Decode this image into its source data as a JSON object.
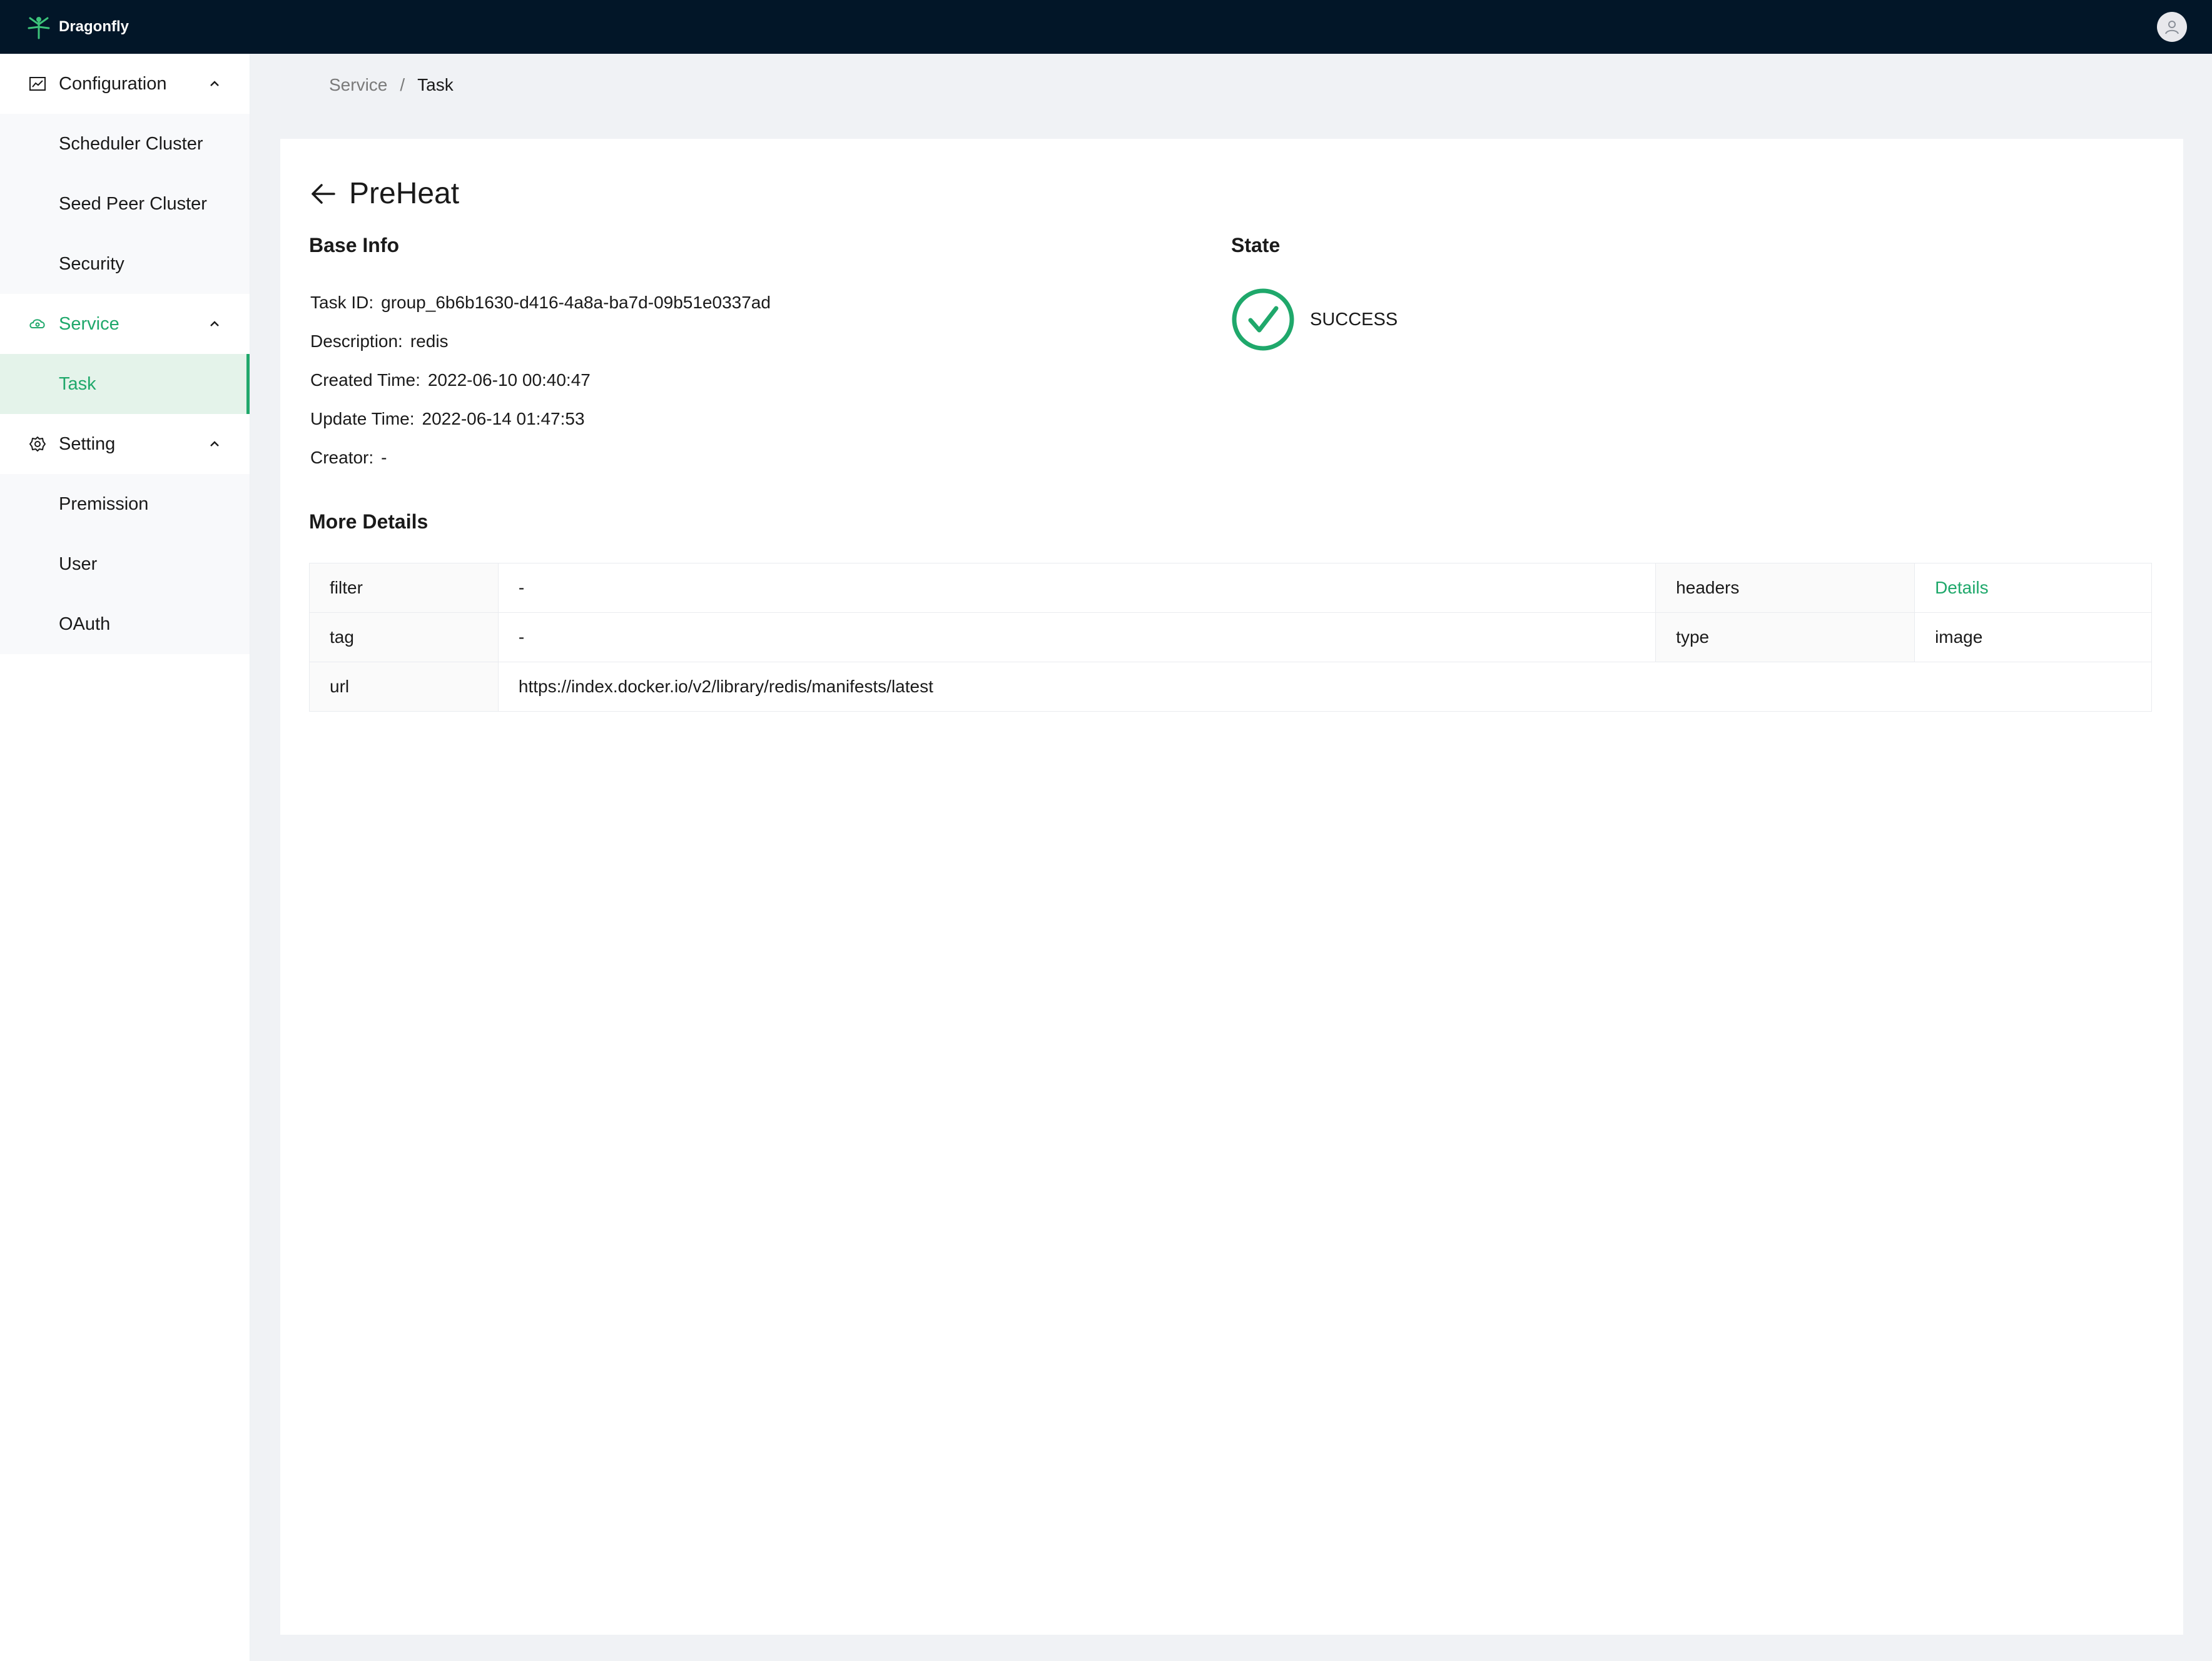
{
  "app": {
    "brand": "Dragonfly",
    "accent_color": "#1fa86b",
    "topbar_color": "#021628"
  },
  "sidebar": {
    "groups": [
      {
        "label": "Configuration",
        "icon": "chart-icon",
        "items": [
          {
            "label": "Scheduler Cluster"
          },
          {
            "label": "Seed Peer Cluster"
          },
          {
            "label": "Security"
          }
        ]
      },
      {
        "label": "Service",
        "icon": "cloud-icon",
        "items": [
          {
            "label": "Task"
          }
        ]
      },
      {
        "label": "Setting",
        "icon": "gear-icon",
        "items": [
          {
            "label": "Premission"
          },
          {
            "label": "User"
          },
          {
            "label": "OAuth"
          }
        ]
      }
    ]
  },
  "breadcrumb": {
    "parent": "Service",
    "separator": "/",
    "current": "Task"
  },
  "page": {
    "title": "PreHeat",
    "base_info": {
      "heading": "Base Info",
      "fields": [
        {
          "key": "Task ID:",
          "value": "group_6b6b1630-d416-4a8a-ba7d-09b51e0337ad"
        },
        {
          "key": "Description:",
          "value": "redis"
        },
        {
          "key": "Created Time:",
          "value": "2022-06-10 00:40:47"
        },
        {
          "key": "Update Time:",
          "value": "2022-06-14 01:47:53"
        },
        {
          "key": "Creator:",
          "value": "-"
        }
      ]
    },
    "state": {
      "heading": "State",
      "value": "SUCCESS",
      "color": "#1fa86b"
    },
    "more_details": {
      "heading": "More Details",
      "rows": [
        {
          "k1": "filter",
          "v1": "-",
          "k2": "headers",
          "v2": "Details"
        },
        {
          "k1": "tag",
          "v1": "-",
          "k2": "type",
          "v2": "image"
        },
        {
          "k1": "url",
          "v1": "https://index.docker.io/v2/library/redis/manifests/latest"
        }
      ]
    }
  }
}
